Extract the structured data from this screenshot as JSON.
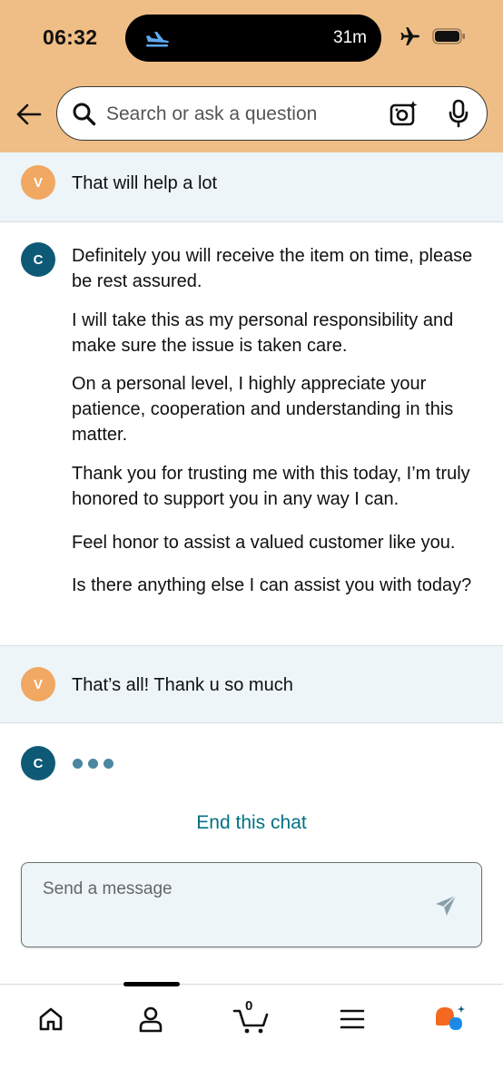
{
  "status_bar": {
    "time": "06:32",
    "activity_timer": "31m",
    "icons": [
      "plane-landing-icon",
      "airplane-mode-icon",
      "battery-icon"
    ]
  },
  "search": {
    "placeholder": "Search or ask a question",
    "icons": [
      "back-arrow-icon",
      "search-icon",
      "camera-icon",
      "microphone-icon"
    ]
  },
  "colors": {
    "header_bg": "#efbe86",
    "user_row_bg": "#edf5f8",
    "customer_avatar": "#f0a862",
    "agent_avatar": "#0e5a76",
    "link": "#007185"
  },
  "chat": {
    "messages": [
      {
        "sender": "customer",
        "avatar": "V",
        "text": "That will help a lot"
      },
      {
        "sender": "agent",
        "avatar": "C",
        "paragraphs": [
          "Definitely you will receive the item on time, please be rest assured.",
          "I will take this as my personal responsibility and make sure the issue is taken care.",
          "On a personal level, I highly appreciate your patience, cooperation and understanding in this matter.",
          "Thank you for trusting me with this today, I’m truly honored to support you in any way I can.",
          "Feel honor to assist a valued customer like you.",
          "Is there anything else I can assist you with today?"
        ]
      },
      {
        "sender": "customer",
        "avatar": "V",
        "text": "That’s all! Thank u so much"
      },
      {
        "sender": "agent",
        "avatar": "C",
        "typing": true
      }
    ],
    "end_chat_label": "End this chat"
  },
  "composer": {
    "placeholder": "Send a message",
    "icons": [
      "send-icon"
    ]
  },
  "bottom_nav": {
    "cart_count": "0",
    "items": [
      "home-icon",
      "account-icon",
      "cart-icon",
      "menu-icon",
      "rufus-ai-icon"
    ]
  }
}
